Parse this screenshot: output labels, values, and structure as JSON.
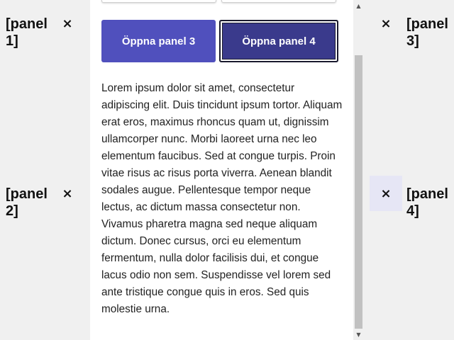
{
  "panels": {
    "panel1": {
      "label": "[panel 1]",
      "close_icon": "×"
    },
    "panel2": {
      "label": "[panel 2]",
      "close_icon": "×"
    },
    "panel3": {
      "label": "[panel 3]",
      "close_icon": "×"
    },
    "panel4": {
      "label": "[panel 4]",
      "close_icon": "×"
    }
  },
  "main": {
    "buttons": {
      "open_panel_3": "Öppna panel 3",
      "open_panel_4": "Öppna panel 4"
    },
    "body_text": "Lorem ipsum dolor sit amet, consectetur adipiscing elit. Duis tincidunt ipsum tortor. Aliquam erat eros, maximus rhoncus quam ut, dignissim ullamcorper nunc. Morbi laoreet urna nec leo elementum faucibus. Sed at congue turpis. Proin vitae risus ac risus porta viverra. Aenean blandit sodales augue. Pellentesque tempor neque lectus, ac dictum massa consectetur non. Vivamus pharetra magna sed neque aliquam dictum. Donec cursus, orci eu elementum fermentum, nulla dolor facilisis dui, et congue lacus odio non sem. Suspendisse vel lorem sed ante tristique congue quis in eros. Sed quis molestie urna."
  },
  "scrollbar": {
    "up_arrow": "▲",
    "down_arrow": "▼"
  },
  "colors": {
    "button_primary": "#5050bd",
    "button_active": "#3a3a8c",
    "active_close_bg": "#e6e6f5"
  }
}
